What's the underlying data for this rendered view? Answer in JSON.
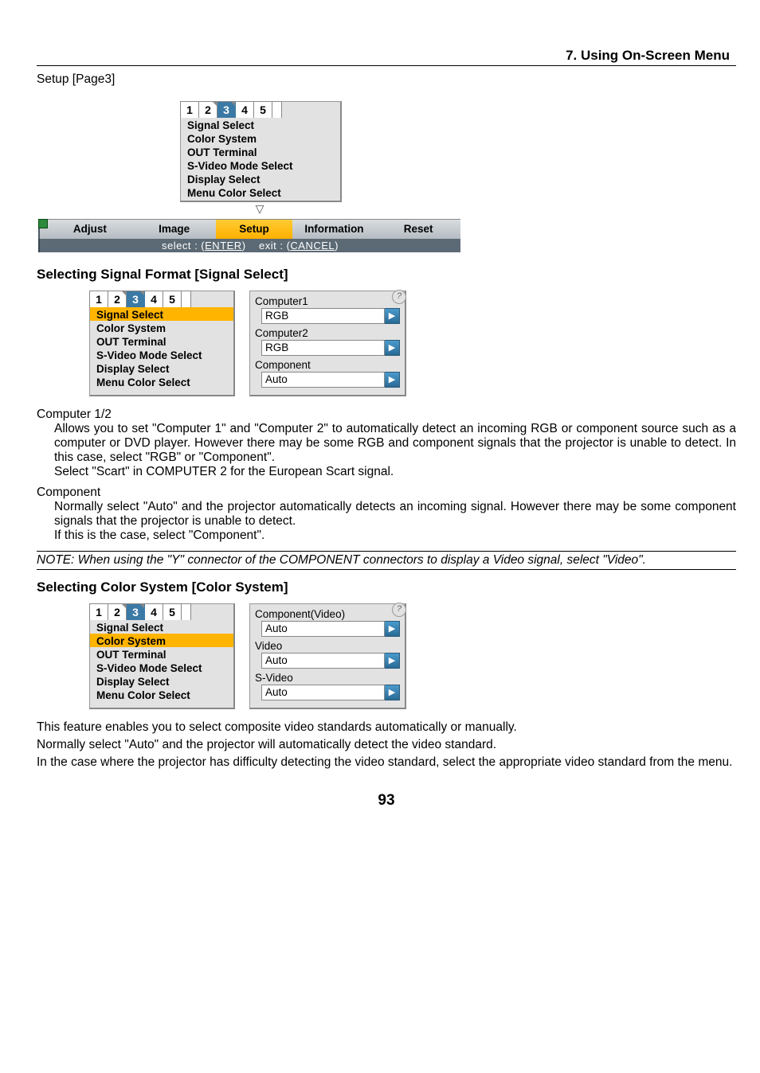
{
  "header": {
    "chapter": "7. Using On-Screen Menu"
  },
  "page_label": "Setup [Page3]",
  "page_number": "93",
  "osd_top": {
    "tabs": [
      "1",
      "2",
      "3",
      "4",
      "5"
    ],
    "active_tab_index": 2,
    "items": [
      "Signal Select",
      "Color System",
      "OUT Terminal",
      "S-Video Mode Select",
      "Display Select",
      "Menu Color Select"
    ],
    "down_indicator": "▽",
    "bottom_tabs": [
      "Adjust",
      "Image",
      "Setup",
      "Information",
      "Reset"
    ],
    "bottom_active_index": 2,
    "hint_select_label": "select :",
    "hint_select_key": "ENTER",
    "hint_exit_label": "exit :",
    "hint_exit_key": "CANCEL"
  },
  "section1": {
    "title": "Selecting Signal Format [Signal Select]",
    "menu": {
      "tabs": [
        "1",
        "2",
        "3",
        "4",
        "5"
      ],
      "active_tab_index": 2,
      "items": [
        "Signal Select",
        "Color System",
        "OUT Terminal",
        "S-Video Mode Select",
        "Display Select",
        "Menu Color Select"
      ],
      "selected_index": 0
    },
    "panel": [
      {
        "label": "Computer1",
        "value": "RGB"
      },
      {
        "label": "Computer2",
        "value": "RGB"
      },
      {
        "label": "Component",
        "value": "Auto"
      }
    ],
    "text": {
      "computer_head": "Computer 1/2",
      "computer_body": "Allows you to set \"Computer 1\" and \"Computer 2\" to automatically detect an incoming RGB or component source such as a computer or DVD player. However there may be some RGB and component signals that the projector is unable to detect. In this case, select \"RGB\" or \"Component\".",
      "computer_body2": "Select \"Scart\" in COMPUTER 2 for the European Scart signal.",
      "component_head": "Component",
      "component_body": "Normally select \"Auto\" and the projector automatically detects an incoming signal. However there may be some component signals that the projector is unable to detect.",
      "component_body2": "If this is the case, select \"Component\".",
      "note": "NOTE: When using the \"Y\" connector of the COMPONENT connectors to display a Video signal, select \"Video\"."
    }
  },
  "section2": {
    "title": "Selecting Color System [Color System]",
    "menu": {
      "tabs": [
        "1",
        "2",
        "3",
        "4",
        "5"
      ],
      "active_tab_index": 2,
      "items": [
        "Signal Select",
        "Color System",
        "OUT Terminal",
        "S-Video Mode Select",
        "Display Select",
        "Menu Color Select"
      ],
      "selected_index": 1
    },
    "panel": [
      {
        "label": "Component(Video)",
        "value": "Auto"
      },
      {
        "label": "Video",
        "value": "Auto"
      },
      {
        "label": "S-Video",
        "value": "Auto"
      }
    ],
    "text": {
      "p1": "This feature enables you to select composite video standards automatically or manually.",
      "p2": "Normally select \"Auto\" and the projector will automatically detect the video standard.",
      "p3": "In the case where the projector has difficulty detecting the video standard, select the appropriate video standard from the menu."
    }
  }
}
